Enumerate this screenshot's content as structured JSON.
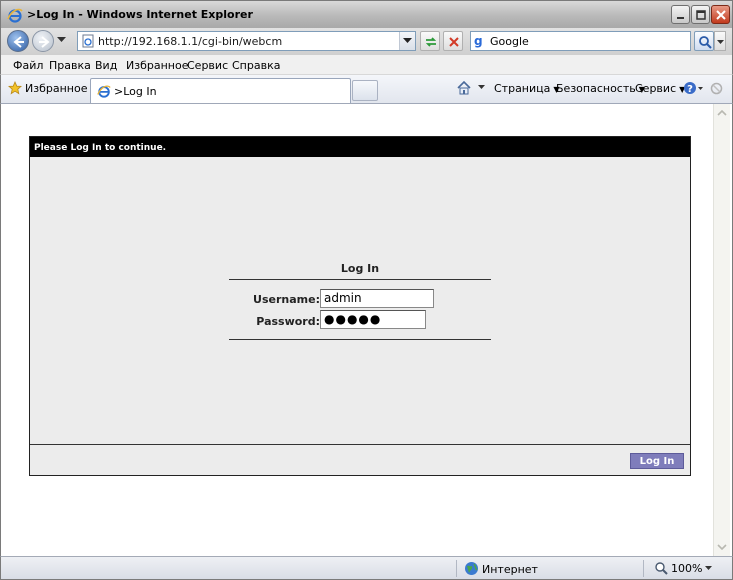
{
  "window": {
    "title": ">Log In - Windows Internet Explorer"
  },
  "address": {
    "url": "http://192.168.1.1/cgi-bin/webcm"
  },
  "search": {
    "placeholder": "Google"
  },
  "menu": [
    "Файл",
    "Правка",
    "Вид",
    "Избранное",
    "Сервис",
    "Справка"
  ],
  "favorites": {
    "label": "Избранное"
  },
  "tab": {
    "label": ">Log In"
  },
  "commands": {
    "page": "Страница",
    "safety": "Безопасность",
    "tools": "Сервис"
  },
  "page": {
    "header": "Please Log In to continue.",
    "form_title": "Log In",
    "username_label": "Username:",
    "username_value": "admin",
    "password_label": "Password:",
    "password_value": "●●●●●",
    "login_button": "Log In"
  },
  "status": {
    "zone": "Интернет",
    "zoom": "100%"
  },
  "colors": {
    "panel_header": "#000000",
    "login_button": "#7f7dbb",
    "panel_bg": "#ececec"
  },
  "icons": [
    "ie-icon",
    "minimize-icon",
    "maximize-icon",
    "close-icon",
    "back-icon",
    "forward-icon",
    "page-icon",
    "refresh-icon",
    "stop-icon",
    "google-icon",
    "search-icon",
    "star-icon",
    "home-icon",
    "help-icon",
    "research-icon",
    "globe-icon",
    "zoom-icon"
  ]
}
